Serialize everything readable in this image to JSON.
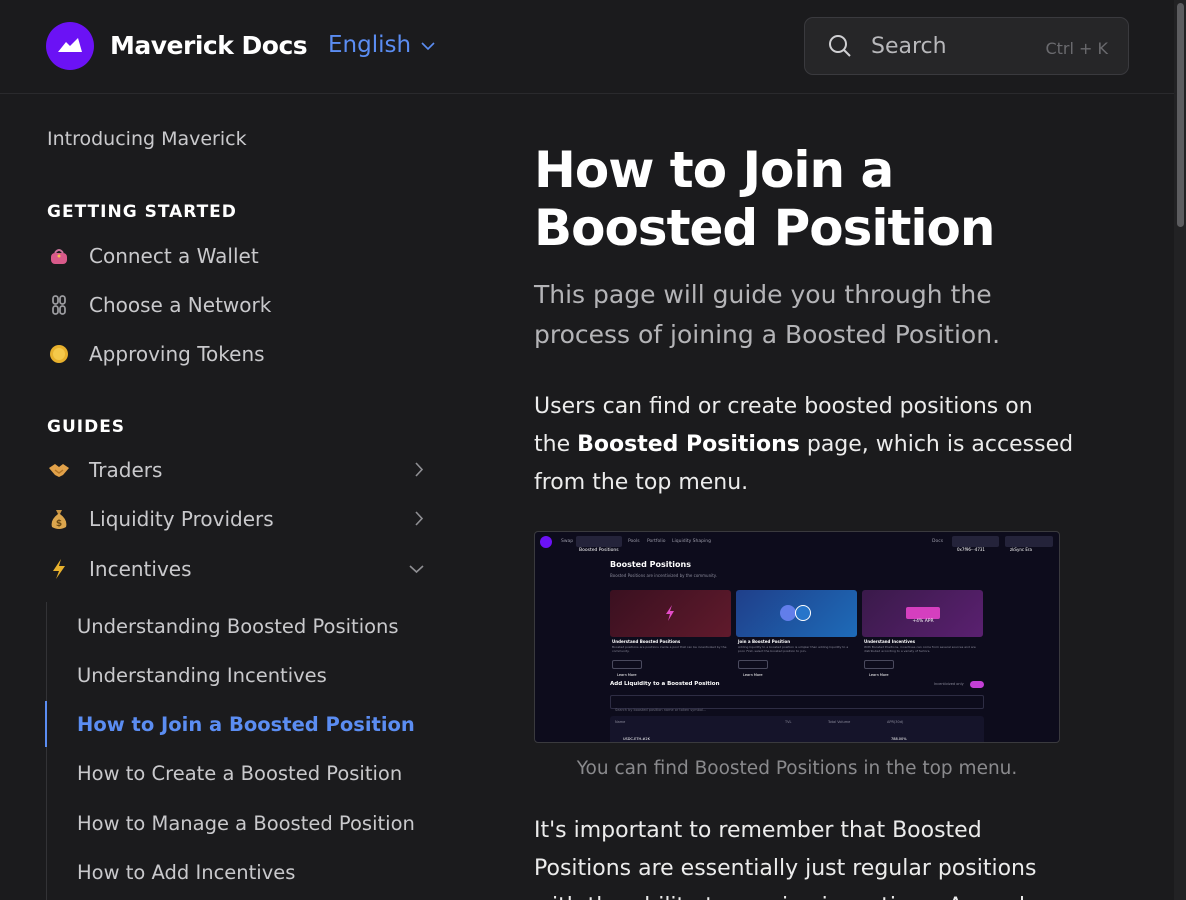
{
  "header": {
    "brand": "Maverick Docs",
    "language": "English",
    "search_placeholder": "Search",
    "search_shortcut": "Ctrl + K"
  },
  "sidebar": {
    "intro": "Introducing Maverick",
    "section_getting_started": "GETTING STARTED",
    "getting_started": [
      {
        "icon": "purse-icon",
        "label": "Connect a Wallet"
      },
      {
        "icon": "chain-icon",
        "label": "Choose a Network"
      },
      {
        "icon": "coin-icon",
        "label": "Approving Tokens"
      }
    ],
    "section_guides": "GUIDES",
    "guides": [
      {
        "icon": "handshake-icon",
        "label": "Traders"
      },
      {
        "icon": "money-bag-icon",
        "label": "Liquidity Providers"
      },
      {
        "icon": "lightning-icon",
        "label": "Incentives"
      }
    ],
    "incentives_sub": [
      {
        "label": "Understanding Boosted Positions"
      },
      {
        "label": "Understanding Incentives"
      },
      {
        "label": "How to Join a Boosted Position"
      },
      {
        "label": "How to Create a Boosted Position"
      },
      {
        "label": "How to Manage a Boosted Position"
      },
      {
        "label": "How to Add Incentives"
      }
    ]
  },
  "main": {
    "title": "How to Join a Boosted Position",
    "subtitle": "This page will guide you through the process of joining a Boosted Position.",
    "para1_pre": "Users can find or create boosted positions on the ",
    "para1_bold": "Boosted Positions",
    "para1_post": " page, which is accessed from  the top menu.",
    "caption": "You can find Boosted Positions in the top menu.",
    "para2": "It's important to remember that Boosted Positions are essentially just regular positions with the ability to receive incentives. As such,"
  },
  "screenshot": {
    "nav": [
      "Swap",
      "Boosted Positions",
      "Pools",
      "Portfolio",
      "Liquidity Shaping"
    ],
    "docs": "Docs",
    "address": "0x7f96···4731",
    "network": "zkSync Era",
    "heading": "Boosted Positions",
    "subheading": "Boosted Positions are incentivized by the community.",
    "cards": [
      {
        "title": "Understand Boosted Positions",
        "desc": "Boosted positions are positions inside a pool that can be incentivized by the community.",
        "cta": "Learn More"
      },
      {
        "title": "Join a Boosted Position",
        "desc": "Adding liquidity to a boosted position is simpler than adding liquidity to a pool. First, select the boosted position to join.",
        "cta": "Learn More"
      },
      {
        "title": "Understand Incentives",
        "desc": "With Boosted Positions, incentives can come from several sources and are distributed according to a variety of factors.",
        "cta": "Learn More"
      }
    ],
    "apr_badge": "+4% APR",
    "add_liquidity": "Add Liquidity to a Boosted Position",
    "incentivized_only": "Incentivized only",
    "search_placeholder": "Search by boosted position name or token symbol...",
    "table_headers": [
      "Name",
      "TVL",
      "Total Volume",
      "APR(30d)"
    ],
    "row_name": "USDC-ETH-#2K",
    "row_apr": "788.00%"
  },
  "colors": {
    "background": "#1b1b1d",
    "accent": "#5b8df2",
    "logo": "#6b12f5"
  }
}
